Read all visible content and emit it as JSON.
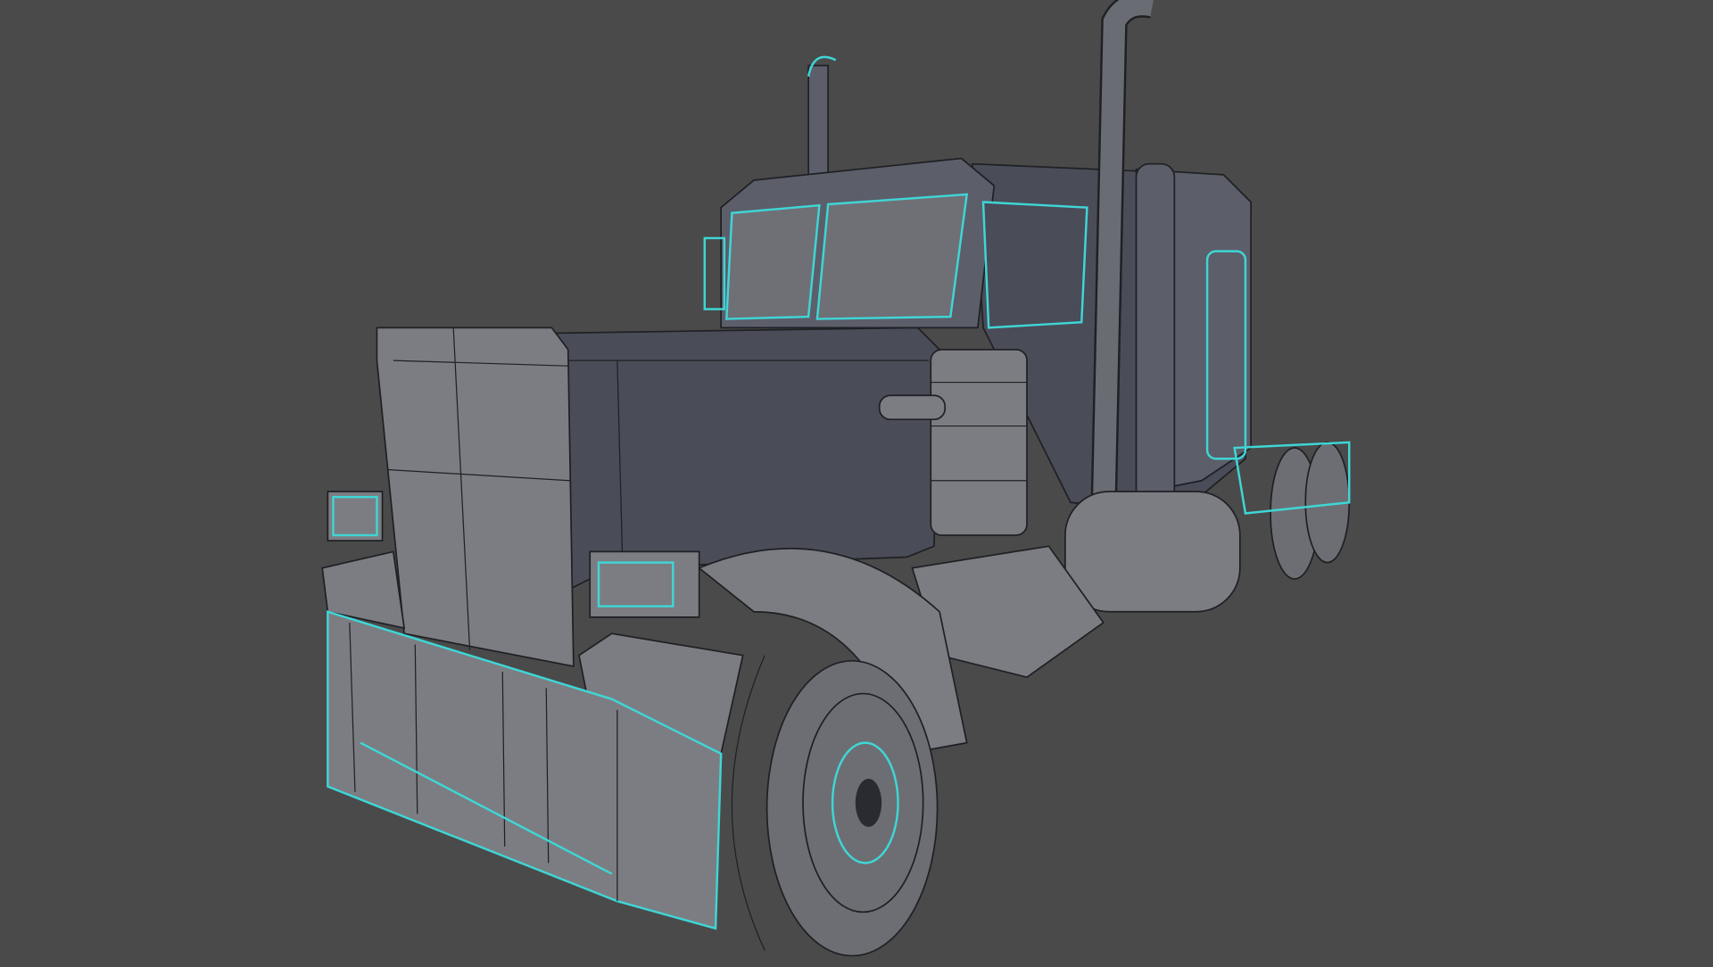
{
  "scene": {
    "subject": "semi-truck-wireframe-model",
    "colors": {
      "background": "#4a4a4a",
      "mesh_fill": "#5c5e6a",
      "wire": "#1e2024",
      "selection_edge": "#3fd6d6"
    }
  }
}
